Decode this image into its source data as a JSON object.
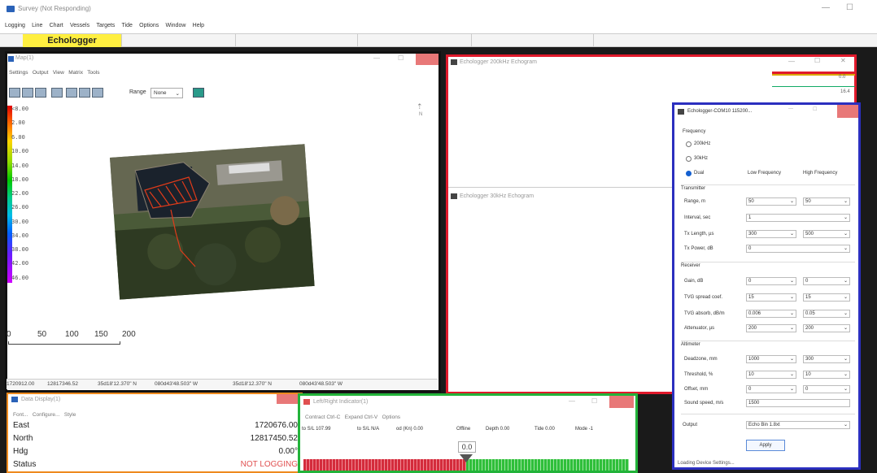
{
  "app": {
    "title": "Survey (Not Responding)",
    "menu": [
      "Logging",
      "Line",
      "Chart",
      "Vessels",
      "Targets",
      "Tide",
      "Options",
      "Window",
      "Help"
    ],
    "active_tab": "Echologger"
  },
  "map_window": {
    "title": "Map(1)",
    "menu": [
      "Settings",
      "Output",
      "View",
      "Matrix",
      "Tools"
    ],
    "range_label": "Range",
    "range_value": "None",
    "legend": [
      "<8.00",
      "2.00",
      "6.00",
      "10.00",
      "14.00",
      "18.00",
      "22.00",
      "26.00",
      "30.00",
      "34.00",
      "38.00",
      "42.00",
      "46.00"
    ],
    "scale_labels": [
      "0",
      "50",
      "100",
      "150",
      "200"
    ],
    "status": [
      "1720912.00",
      "12817346.52",
      "35d18'12.370\" N",
      "080d43'48.503\" W",
      "35d18'12.370\" N",
      "080d43'48.503\" W"
    ]
  },
  "echogram_window": {
    "title": "Echologger 200kHz Echogram",
    "value1": "0.0",
    "value2": "16.4"
  },
  "echogram30_window": {
    "title": "Echologger 30kHz Echogram"
  },
  "device_window": {
    "title": "Echologger-COM10 115200...",
    "frequency_label": "Frequency",
    "freq_options": [
      "200kHz",
      "30kHz",
      "Dual"
    ],
    "low_freq_label": "Low Frequency",
    "high_freq_label": "High Frequency",
    "transmitter_label": "Transmitter",
    "tx_fields": [
      {
        "label": "Range, m",
        "low": "50",
        "high": "50",
        "dropdown": true
      },
      {
        "label": "Interval, sec",
        "low": "1",
        "high": "",
        "dropdown": true
      },
      {
        "label": "Tx Length, µs",
        "low": "300",
        "high": "500",
        "dropdown": true
      },
      {
        "label": "Tx Power, dB",
        "low": "0",
        "high": "",
        "dropdown": true
      }
    ],
    "receiver_label": "Receiver",
    "rx_fields": [
      {
        "label": "Gain, dB",
        "low": "0",
        "high": "0"
      },
      {
        "label": "TVG spread coef.",
        "low": "15",
        "high": "15"
      },
      {
        "label": "TVG absorb, dB/m",
        "low": "0.006",
        "high": "0.05"
      },
      {
        "label": "Attenuator, µs",
        "low": "200",
        "high": "200"
      }
    ],
    "altimeter_label": "Altimeter",
    "alt_fields": [
      {
        "label": "Deadzone, mm",
        "low": "1000",
        "high": "300"
      },
      {
        "label": "Threshold, %",
        "low": "10",
        "high": "10"
      },
      {
        "label": "Offset, mm",
        "low": "0",
        "high": "0"
      }
    ],
    "sound_speed_label": "Sound speed, m/s",
    "sound_speed_value": "1500",
    "output_label": "Output",
    "output_value": "Echo Bin 1.8xt",
    "apply_label": "Apply",
    "status_text": "Loading Device Settings..."
  },
  "data_display": {
    "title": "Data Display(1)",
    "menu": [
      "Font...",
      "Configure...",
      "Style"
    ],
    "rows": [
      {
        "label": "East",
        "value": "1720676.00"
      },
      {
        "label": "North",
        "value": "12817450.52"
      },
      {
        "label": "Hdg",
        "value": "0.00°"
      },
      {
        "label": "Status",
        "value": "NOT LOGGING"
      }
    ]
  },
  "lr_indicator": {
    "title": "Left/Right Indicator(1)",
    "menu": [
      "Contract Ctrl-C",
      "Expand Ctrl-V",
      "Options"
    ],
    "info": [
      "to S/L 107.99",
      "to S/L N/A",
      "od (Kn) 0.00",
      "Offline",
      "Depth 0.00",
      "Tide 0.00",
      "Mode -1"
    ],
    "center_value": "0.0"
  },
  "colors": {
    "red": "#e0192b",
    "blue": "#2b2fbf",
    "green": "#22b33a",
    "orange": "#ee8a1e",
    "tab_yellow": "#ffef40"
  }
}
